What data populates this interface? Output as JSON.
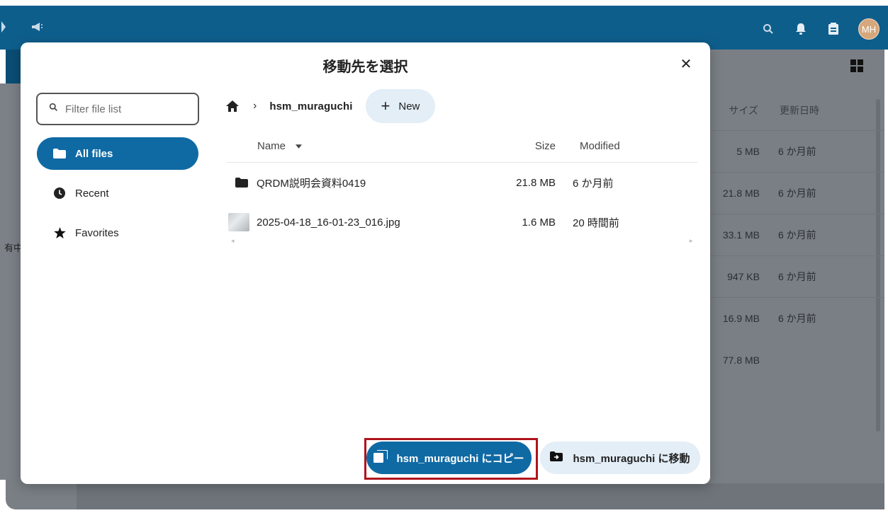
{
  "background": {
    "left_text": "有中",
    "table_header": {
      "size": "サイズ",
      "modified": "更新日時"
    },
    "rows": [
      {
        "size": "5 MB",
        "modified": "6 か月前"
      },
      {
        "size": "21.8 MB",
        "modified": "6 か月前"
      },
      {
        "size": "33.1 MB",
        "modified": "6 か月前"
      },
      {
        "size": "947 KB",
        "modified": "6 か月前"
      },
      {
        "size": "16.9 MB",
        "modified": "6 か月前"
      },
      {
        "size": "77.8 MB",
        "modified": ""
      }
    ],
    "avatar_initials": "MH"
  },
  "modal": {
    "title": "移動先を選択",
    "close_label": "✕",
    "filter_placeholder": "Filter file list",
    "nav": [
      {
        "label": "All files",
        "icon": "folder-icon"
      },
      {
        "label": "Recent",
        "icon": "clock-icon"
      },
      {
        "label": "Favorites",
        "icon": "star-icon"
      }
    ],
    "breadcrumb": {
      "separator": "›",
      "folder": "hsm_muraguchi"
    },
    "new_button": {
      "plus": "+",
      "label": "New"
    },
    "columns": {
      "name": "Name",
      "size": "Size",
      "modified": "Modified"
    },
    "files": [
      {
        "name": "QRDM説明会資料0419",
        "size": "21.8 MB",
        "modified": "6 か月前",
        "icon": "folder-icon"
      },
      {
        "name": "2025-04-18_16-01-23_016.jpg",
        "size": "1.6 MB",
        "modified": "20 時間前",
        "icon": "image-thumbnail"
      }
    ],
    "copy_button": "hsm_muraguchi にコピー",
    "move_button": "hsm_muraguchi に移動"
  },
  "colors": {
    "primary": "#0f6aa4",
    "header": "#0e5e8c",
    "highlight": "#b0141c",
    "secondary_button": "#e3eef7"
  }
}
